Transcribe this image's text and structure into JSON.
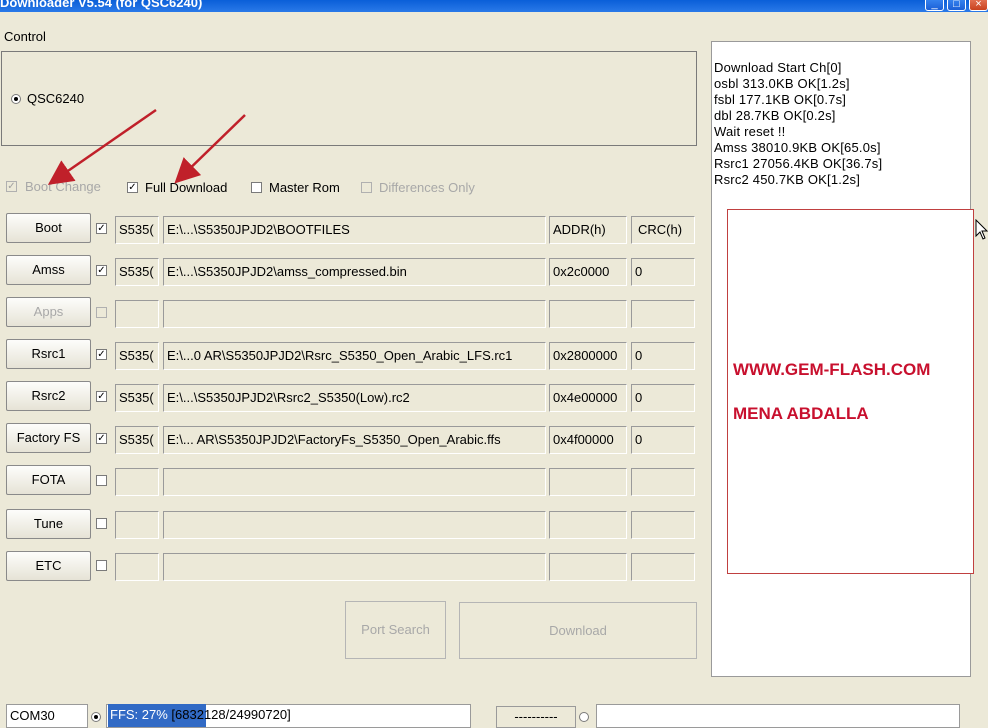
{
  "window": {
    "title": "Downloader V5.54  (for QSC6240)"
  },
  "control": {
    "group_label": "Control",
    "chip_option": "QSC6240"
  },
  "options": {
    "boot_change": "Boot Change",
    "full_download": "Full Download",
    "master_rom": "Master Rom",
    "differences_only": "Differences Only"
  },
  "headers": {
    "addr": "ADDR(h)",
    "crc": "CRC(h)"
  },
  "rows": [
    {
      "button": "Boot",
      "short": "S535(",
      "path": "E:\\...\\S5350JPJD2\\BOOTFILES",
      "addr": "",
      "crc": "",
      "checked": true,
      "enabled": true
    },
    {
      "button": "Amss",
      "short": "S535(",
      "path": "E:\\...\\S5350JPJD2\\amss_compressed.bin",
      "addr": "0x2c0000",
      "crc": "0",
      "checked": true,
      "enabled": true
    },
    {
      "button": "Apps",
      "short": "",
      "path": "",
      "addr": "",
      "crc": "",
      "checked": false,
      "enabled": false
    },
    {
      "button": "Rsrc1",
      "short": "S535(",
      "path": "E:\\...0 AR\\S5350JPJD2\\Rsrc_S5350_Open_Arabic_LFS.rc1",
      "addr": "0x2800000",
      "crc": "0",
      "checked": true,
      "enabled": true
    },
    {
      "button": "Rsrc2",
      "short": "S535(",
      "path": "E:\\...\\S5350JPJD2\\Rsrc2_S5350(Low).rc2",
      "addr": "0x4e00000",
      "crc": "0",
      "checked": true,
      "enabled": true
    },
    {
      "button": "Factory FS",
      "short": "S535(",
      "path": "E:\\... AR\\S5350JPJD2\\FactoryFs_S5350_Open_Arabic.ffs",
      "addr": "0x4f00000",
      "crc": "0",
      "checked": true,
      "enabled": true
    },
    {
      "button": "FOTA",
      "short": "",
      "path": "",
      "addr": "",
      "crc": "",
      "checked": false,
      "enabled": true
    },
    {
      "button": "Tune",
      "short": "",
      "path": "",
      "addr": "",
      "crc": "",
      "checked": false,
      "enabled": true
    },
    {
      "button": "ETC",
      "short": "",
      "path": "",
      "addr": "",
      "crc": "",
      "checked": false,
      "enabled": true
    }
  ],
  "actions": {
    "port_search": "Port Search",
    "download": "Download"
  },
  "log": {
    "lines": [
      "Download Start Ch[0]",
      "osbl 313.0KB OK[1.2s]",
      "fsbl 177.1KB OK[0.7s]",
      "dbl 28.7KB OK[0.2s]",
      "Wait reset !!",
      "Amss 38010.9KB OK[65.0s]",
      "Rsrc1 27056.4KB OK[36.7s]",
      "Rsrc2 450.7KB OK[1.2s]"
    ]
  },
  "promo": {
    "line1": "WWW.GEM-FLASH.COM",
    "line2": "MENA ABDALLA"
  },
  "status": {
    "port": "COM30",
    "progress_label": "FFS:  27%",
    "progress_detail": " [6832128/24990720]",
    "progress_fraction": 0.27,
    "second_port": "----------"
  },
  "colors": {
    "titlebar": "#0a5fd8",
    "promo_text": "#c8102e",
    "progress": "#316ac5",
    "annotation_arrow": "#c0202a"
  }
}
